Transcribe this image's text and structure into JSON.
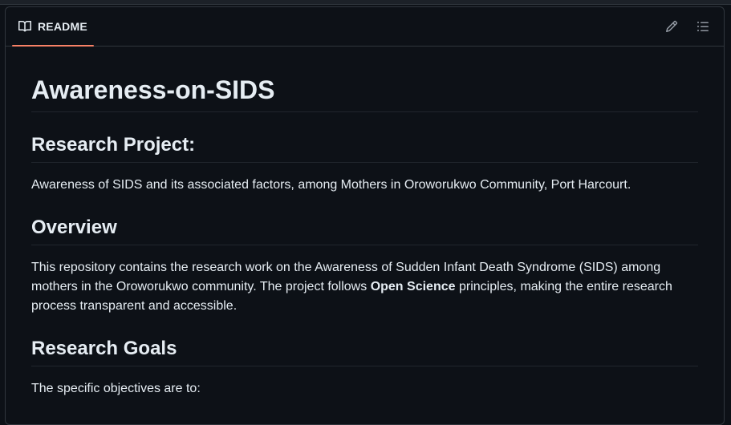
{
  "readme": {
    "tab_label": "README",
    "tab_icon": "book-icon",
    "edit_icon": "pencil-icon",
    "outline_icon": "list-unordered-icon"
  },
  "content": {
    "title": "Awareness-on-SIDS",
    "research_project": {
      "heading": "Research Project:",
      "text": "Awareness of SIDS and its associated factors, among Mothers in Oroworukwo Community, Port Harcourt."
    },
    "overview": {
      "heading": "Overview",
      "text_before": "This repository contains the research work on the Awareness of Sudden Infant Death Syndrome (SIDS) among mothers in the Oroworukwo community. The project follows ",
      "bold": "Open Science",
      "text_after": " principles, making the entire research process transparent and accessible."
    },
    "research_goals": {
      "heading": "Research Goals",
      "text": "The specific objectives are to:"
    }
  },
  "colors": {
    "background": "#0d1117",
    "border": "#30363d",
    "text": "#e6edf3",
    "muted": "#9198a1",
    "tab_accent": "#f78166"
  }
}
